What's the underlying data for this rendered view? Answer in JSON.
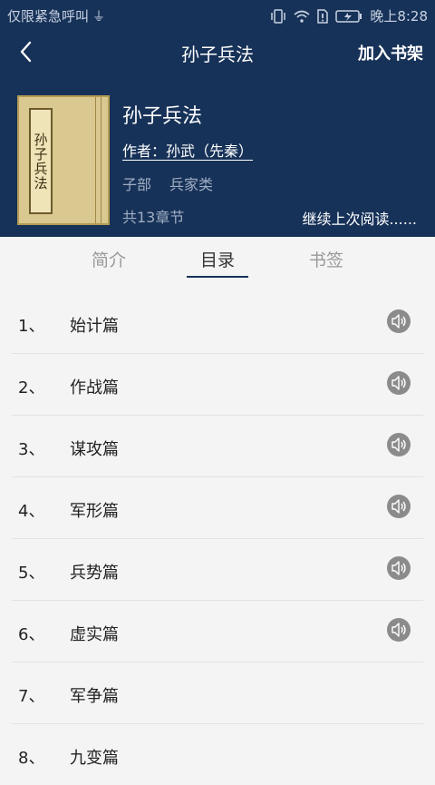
{
  "status": {
    "left_text": "仅限紧急呼叫",
    "usb_icon": "usb-icon",
    "time": "晚上8:28"
  },
  "nav": {
    "back_icon": "chevron-left-icon",
    "title": "孙子兵法",
    "add_shelf_label": "加入书架"
  },
  "book": {
    "cover_text": "孙子兵法",
    "title": "孙子兵法",
    "author": "作者：孙武（先秦）",
    "tags": [
      "子部",
      "兵家类"
    ],
    "chapter_count": "共13章节",
    "continue_label": "继续上次阅读......"
  },
  "tabs": [
    {
      "label": "简介",
      "active": false
    },
    {
      "label": "目录",
      "active": true
    },
    {
      "label": "书签",
      "active": false
    }
  ],
  "chapters": [
    {
      "num": "1、",
      "name": "始计篇",
      "audio": true
    },
    {
      "num": "2、",
      "name": "作战篇",
      "audio": true
    },
    {
      "num": "3、",
      "name": "谋攻篇",
      "audio": true
    },
    {
      "num": "4、",
      "name": "军形篇",
      "audio": true
    },
    {
      "num": "5、",
      "name": "兵势篇",
      "audio": true
    },
    {
      "num": "6、",
      "name": "虚实篇",
      "audio": true
    },
    {
      "num": "7、",
      "name": "军争篇",
      "audio": false
    },
    {
      "num": "8、",
      "name": "九变篇",
      "audio": false
    }
  ],
  "colors": {
    "header_bg": "#173258",
    "cover_bg": "#d9c88f",
    "audio_bg": "#8b8b8b"
  }
}
